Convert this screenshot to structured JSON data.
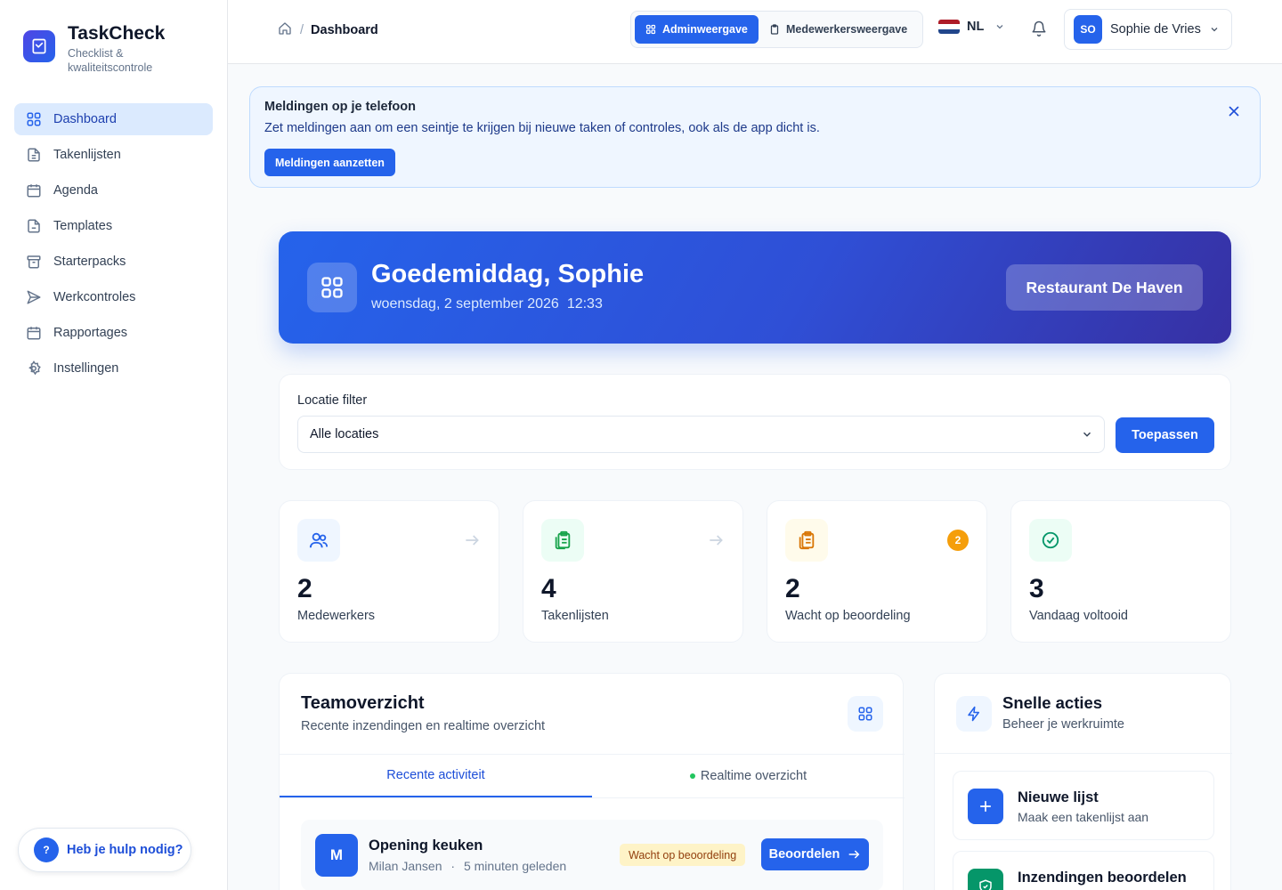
{
  "brand": {
    "name": "TaskCheck",
    "subtitle": "Checklist & kwaliteitscontrole"
  },
  "sidebar": {
    "items": [
      {
        "label": "Dashboard",
        "icon": "grid-icon",
        "active": true
      },
      {
        "label": "Takenlijsten",
        "icon": "document-icon"
      },
      {
        "label": "Agenda",
        "icon": "calendar-icon"
      },
      {
        "label": "Templates",
        "icon": "file-icon"
      },
      {
        "label": "Starterpacks",
        "icon": "archive-icon"
      },
      {
        "label": "Werkcontroles",
        "icon": "send-icon"
      },
      {
        "label": "Rapportages",
        "icon": "calendar-icon"
      },
      {
        "label": "Instellingen",
        "icon": "gear-icon"
      }
    ],
    "help_label": "Heb je hulp nodig?",
    "help_icon_text": "?"
  },
  "header": {
    "breadcrumb_current": "Dashboard",
    "breadcrumb_sep": "/",
    "admin_view": "Adminweergave",
    "employee_view": "Medewerkersweergave",
    "language": "NL",
    "user_initials": "SO",
    "user_name": "Sophie de Vries"
  },
  "banner": {
    "title": "Meldingen op je telefoon",
    "text": "Zet meldingen aan om een seintje te krijgen bij nieuwe taken of controles, ook als de app dicht is.",
    "button": "Meldingen aanzetten"
  },
  "hero": {
    "greeting": "Goedemiddag, Sophie",
    "date": "woensdag, 2 september 2026",
    "time": "12:33",
    "location": "Restaurant De Haven"
  },
  "filter": {
    "label": "Locatie filter",
    "value": "Alle locaties",
    "apply": "Toepassen"
  },
  "stats": [
    {
      "value": "2",
      "label": "Medewerkers",
      "accent": "#2563eb"
    },
    {
      "value": "4",
      "label": "Takenlijsten",
      "accent": "#16a34a"
    },
    {
      "value": "2",
      "label": "Wacht op beoordeling",
      "accent": "#d97706",
      "badge": "2"
    },
    {
      "value": "3",
      "label": "Vandaag voltooid",
      "accent": "#059669"
    }
  ],
  "team": {
    "title": "Teamoverzicht",
    "subtitle": "Recente inzendingen en realtime overzicht",
    "tabs": [
      "Recente activiteit",
      "Realtime overzicht"
    ],
    "activity": {
      "initial": "M",
      "title": "Opening keuken",
      "person": "Milan Jansen",
      "dot": "·",
      "time": "5 minuten geleden",
      "status": "Wacht op beoordeling",
      "button": "Beoordelen"
    }
  },
  "quick": {
    "title": "Snelle acties",
    "subtitle": "Beheer je werkruimte",
    "actions": [
      {
        "title": "Nieuwe lijst",
        "subtitle": "Maak een takenlijst aan"
      },
      {
        "title": "Inzendingen beoordelen",
        "subtitle": ""
      }
    ]
  },
  "colors": {
    "primary": "#2563eb",
    "active_bg": "#dbeafe",
    "warning": "#f59e0b",
    "success": "#16a34a"
  }
}
